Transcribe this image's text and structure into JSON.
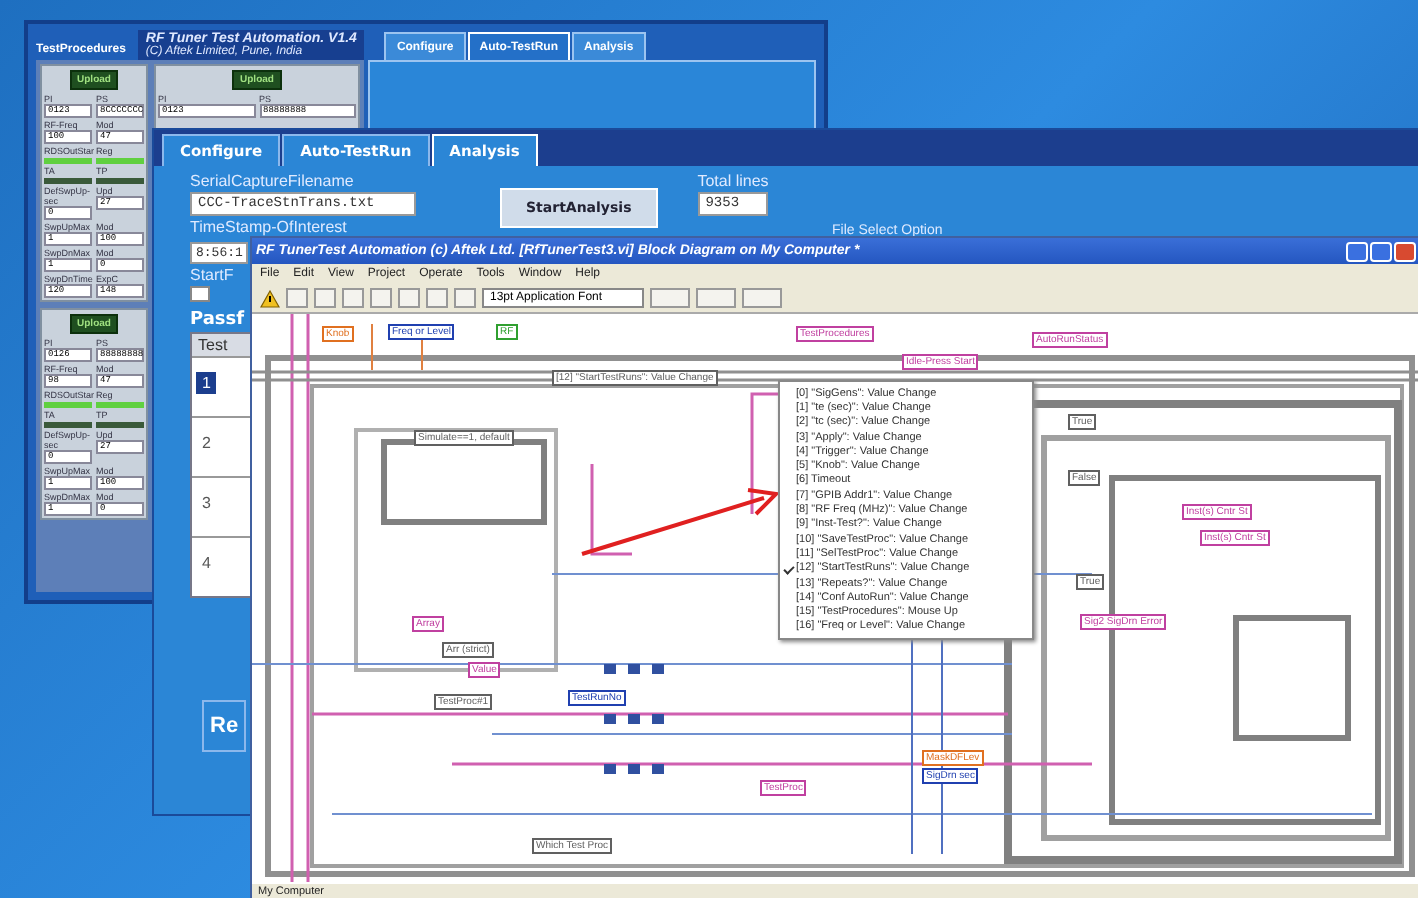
{
  "tuner_panel": {
    "procedures_label": "TestProcedures",
    "title": "RF Tuner Test Automation. V1.4",
    "subtitle": "(C) Aftek Limited, Pune, India",
    "tabs": [
      {
        "label": "Configure",
        "selected": false
      },
      {
        "label": "Auto-TestRun",
        "selected": true
      },
      {
        "label": "Analysis",
        "selected": false
      }
    ],
    "cards": [
      {
        "button": "Upload",
        "fields": [
          {
            "kind": "text",
            "label": "PI",
            "value": "0123"
          },
          {
            "kind": "text",
            "label": "PS",
            "value": "8CCCCCCC"
          },
          {
            "kind": "text",
            "label": "RF-Freq",
            "value": "100"
          },
          {
            "kind": "text",
            "label": "Mod",
            "value": "47"
          },
          {
            "kind": "led",
            "label": "RDSOutStar",
            "on": true
          },
          {
            "kind": "led",
            "label": "Reg",
            "on": true
          },
          {
            "kind": "led",
            "label": "TA",
            "on": false
          },
          {
            "kind": "led",
            "label": "TP",
            "on": false
          },
          {
            "kind": "text",
            "label": "DefSwpUp-sec",
            "value": "0"
          },
          {
            "kind": "text",
            "label": "Upd",
            "value": "27"
          },
          {
            "kind": "text",
            "label": "SwpUpMax",
            "value": "1"
          },
          {
            "kind": "text",
            "label": "Mod",
            "value": "100"
          },
          {
            "kind": "text",
            "label": "SwpDnMax",
            "value": "1"
          },
          {
            "kind": "text",
            "label": "Mod",
            "value": "0"
          },
          {
            "kind": "text",
            "label": "SwpDnTime",
            "value": "120"
          },
          {
            "kind": "text",
            "label": "ExpC",
            "value": "148"
          }
        ]
      },
      {
        "button": "Upload",
        "fields": [
          {
            "kind": "text",
            "label": "PI",
            "value": "0123"
          },
          {
            "kind": "text",
            "label": "PS",
            "value": "88888888"
          }
        ]
      },
      {
        "button": "Upload",
        "fields": [
          {
            "kind": "text",
            "label": "PI",
            "value": "0126"
          },
          {
            "kind": "text",
            "label": "PS",
            "value": "88888888"
          },
          {
            "kind": "text",
            "label": "RF-Freq",
            "value": "98"
          },
          {
            "kind": "text",
            "label": "Mod",
            "value": "47"
          },
          {
            "kind": "led",
            "label": "RDSOutStar",
            "on": true
          },
          {
            "kind": "led",
            "label": "Reg",
            "on": true
          },
          {
            "kind": "led",
            "label": "TA",
            "on": false
          },
          {
            "kind": "led",
            "label": "TP",
            "on": false
          },
          {
            "kind": "text",
            "label": "DefSwpUp-sec",
            "value": "0"
          },
          {
            "kind": "text",
            "label": "Upd",
            "value": "27"
          },
          {
            "kind": "text",
            "label": "SwpUpMax",
            "value": "1"
          },
          {
            "kind": "text",
            "label": "Mod",
            "value": "100"
          },
          {
            "kind": "text",
            "label": "SwpDnMax",
            "value": "1"
          },
          {
            "kind": "text",
            "label": "Mod",
            "value": "0"
          }
        ]
      }
    ]
  },
  "analysis_panel": {
    "tabs": [
      {
        "label": "Configure",
        "selected": false
      },
      {
        "label": "Auto-TestRun",
        "selected": false
      },
      {
        "label": "Analysis",
        "selected": true
      }
    ],
    "filename_label": "SerialCaptureFilename",
    "filename": "CCC-TraceStnTrans.txt",
    "start_button": "StartAnalysis",
    "total_label": "Total lines",
    "total": "9353",
    "timestamp_label": "TimeStamp-OfInterest",
    "timestamp": "8:56:1",
    "start_label": "StartF",
    "start_checked": false,
    "pass_label": "Passf",
    "table_header": "Test",
    "rows": [
      {
        "number": "1",
        "selected": true
      },
      {
        "number": "2",
        "selected": false
      },
      {
        "number": "3",
        "selected": false
      },
      {
        "number": "4",
        "selected": false
      }
    ],
    "re_button": "Re",
    "file_option_label": "File Select Option"
  },
  "block_diagram": {
    "title": "RF TunerTest Automation (c) Aftek Ltd. [RfTunerTest3.vi] Block Diagram on My Computer *",
    "menu": [
      "File",
      "Edit",
      "View",
      "Project",
      "Operate",
      "Tools",
      "Window",
      "Help"
    ],
    "font": "13pt Application Font",
    "labels": [
      {
        "text": "TestProcedures",
        "color": "#c040a0"
      },
      {
        "text": "Idle-Press Start",
        "color": "#c040a0"
      },
      {
        "text": "AutoRunStatus",
        "color": "#c040a0"
      },
      {
        "text": "Knob",
        "color": "#e07020"
      },
      {
        "text": "Freq or Level",
        "color": "#2040b0"
      },
      {
        "text": "RF",
        "color": "#30a030"
      },
      {
        "text": "[12] \"StartTestRuns\": Value Change",
        "color": "#606060"
      },
      {
        "text": "Simulate==1, default",
        "color": "#606060"
      },
      {
        "text": "Array",
        "color": "#c040a0"
      },
      {
        "text": "Arr (strict)",
        "color": "#606060"
      },
      {
        "text": "Value",
        "color": "#c040a0"
      },
      {
        "text": "TestProc#1",
        "color": "#606060"
      },
      {
        "text": "TestRunNo",
        "color": "#2040b0"
      },
      {
        "text": "Which Test Proc",
        "color": "#606060"
      },
      {
        "text": "TestProc",
        "color": "#c040a0"
      },
      {
        "text": "MaskDFLev",
        "color": "#e07020"
      },
      {
        "text": "SigDrn sec",
        "color": "#2040b0"
      },
      {
        "text": "True",
        "color": "#606060"
      },
      {
        "text": "False",
        "color": "#606060"
      },
      {
        "text": "True",
        "color": "#606060"
      },
      {
        "text": "Sig2 SigDrn Error",
        "color": "#c040a0"
      },
      {
        "text": "Inst(s) Cntr St",
        "color": "#c040a0"
      },
      {
        "text": "Inst(s) Cntr St",
        "color": "#c040a0"
      }
    ],
    "events": [
      {
        "label": "[0] \"SigGens\": Value Change",
        "checked": false
      },
      {
        "label": "[1] \"te (sec)\": Value Change",
        "checked": false
      },
      {
        "label": "[2] \"tc (sec)\": Value Change",
        "checked": false
      },
      {
        "label": "[3] \"Apply\": Value Change",
        "checked": false
      },
      {
        "label": "[4] \"Trigger\": Value Change",
        "checked": false
      },
      {
        "label": "[5] \"Knob\": Value Change",
        "checked": false
      },
      {
        "label": "[6] Timeout",
        "checked": false
      },
      {
        "label": "[7] \"GPIB Addr1\": Value Change",
        "checked": false
      },
      {
        "label": "[8] \"RF Freq (MHz)\": Value Change",
        "checked": false
      },
      {
        "label": "[9] \"Inst-Test?\": Value Change",
        "checked": false
      },
      {
        "label": "[10] \"SaveTestProc\": Value Change",
        "checked": false
      },
      {
        "label": "[11] \"SelTestProc\": Value Change",
        "checked": false
      },
      {
        "label": "[12] \"StartTestRuns\": Value Change",
        "checked": true
      },
      {
        "label": "[13] \"Repeats?\": Value Change",
        "checked": false
      },
      {
        "label": "[14] \"Conf AutoRun\": Value Change",
        "checked": false
      },
      {
        "label": "[15] \"TestProcedures\": Mouse Up",
        "checked": false
      },
      {
        "label": "[16] \"Freq or Level\": Value Change",
        "checked": false
      }
    ],
    "status": "My Computer"
  }
}
